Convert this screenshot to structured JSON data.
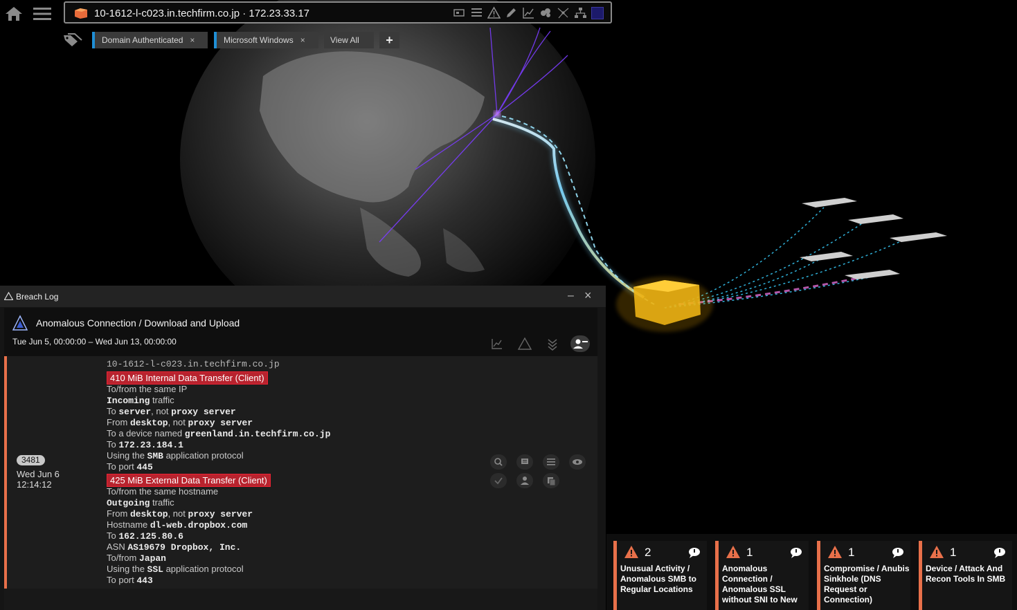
{
  "address_bar": {
    "device_title": "10-1612-l-c023.in.techfirm.co.jp · 172.23.33.17"
  },
  "tags": [
    {
      "label": "Domain Authenticated",
      "remove": "×"
    },
    {
      "label": "Microsoft Windows",
      "remove": "×"
    }
  ],
  "view_all_label": "View All",
  "add_tag_label": "+",
  "breach_log": {
    "panel_title": "Breach Log",
    "minimize": "–",
    "close": "×",
    "breach_title": "Anomalous Connection / Download and Upload",
    "date_range": "Tue Jun 5, 00:00:00 – Wed Jun 13, 00:00:00",
    "event": {
      "id": "3481",
      "date_line1": "Wed Jun 6",
      "date_line2": "12:14:12",
      "hostname_top": "10-1612-l-c023.in.techfirm.co.jp",
      "internal": {
        "badge": "410 MiB Internal Data Transfer (Client)",
        "l1": "To/from the same IP",
        "l2_bold": "Incoming",
        "l2_rest": " traffic",
        "l3_a": "To ",
        "l3_b": "server",
        "l3_c": ", not ",
        "l3_d": "proxy server",
        "l4_a": "From ",
        "l4_b": "desktop",
        "l4_c": ", not ",
        "l4_d": "proxy server",
        "l5_a": "To a device named ",
        "l5_b": "greenland.in.techfirm.co.jp",
        "l6_a": "To ",
        "l6_b": "172.23.184.1",
        "l7_a": "Using the ",
        "l7_b": "SMB",
        "l7_c": " application protocol",
        "l8_a": "To port ",
        "l8_b": "445"
      },
      "external": {
        "badge": "425 MiB External Data Transfer (Client)",
        "l1": "To/from the same hostname",
        "l2_bold": "Outgoing",
        "l2_rest": " traffic",
        "l3_a": "From ",
        "l3_b": "desktop",
        "l3_c": ", not ",
        "l3_d": "proxy server",
        "l4_a": "Hostname ",
        "l4_b": "dl-web.dropbox.com",
        "l5_a": "To ",
        "l5_b": "162.125.80.6",
        "l6_a": "ASN ",
        "l6_b": "AS19679 Dropbox, Inc.",
        "l7_a": "To/from ",
        "l7_b": "Japan",
        "l8_a": "Using the ",
        "l8_b": "SSL",
        "l8_c": " application protocol",
        "l9_a": "To port ",
        "l9_b": "443"
      }
    }
  },
  "model_cards": [
    {
      "count": "2",
      "title": "Unusual Activity / Anomalous SMB to Regular Locations"
    },
    {
      "count": "1",
      "title": "Anomalous Connection / Anomalous SSL without SNI to New"
    },
    {
      "count": "1",
      "title": "Compromise / Anubis Sinkhole (DNS Request or Connection)"
    },
    {
      "count": "1",
      "title": "Device / Attack And Recon Tools In SMB"
    }
  ],
  "colors": {
    "accent_orange": "#e8704a",
    "tag_blue": "#1f8fd6",
    "badge_red": "#b8232e",
    "connection_purple": "#7b3cff",
    "connection_cyan": "#39d0ff",
    "device_gold": "#e8b21a"
  }
}
